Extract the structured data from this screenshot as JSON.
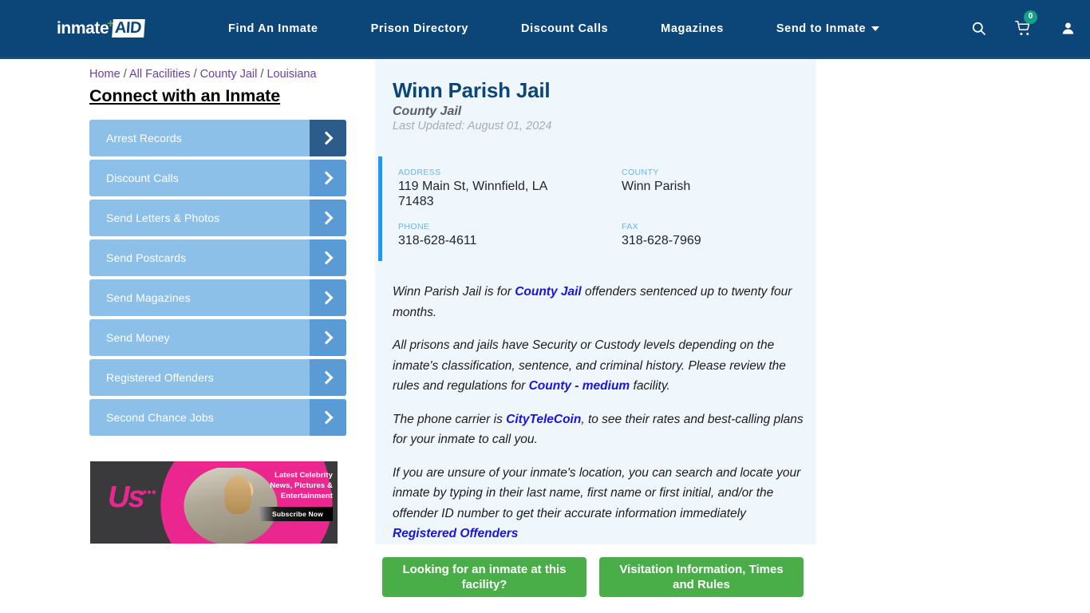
{
  "header": {
    "logo": {
      "word": "inmate",
      "plus": "+",
      "aid": "AID"
    },
    "nav": [
      {
        "label": "Find An Inmate",
        "name": "nav-find-an-inmate"
      },
      {
        "label": "Prison Directory",
        "name": "nav-prison-directory"
      },
      {
        "label": "Discount Calls",
        "name": "nav-discount-calls"
      },
      {
        "label": "Magazines",
        "name": "nav-magazines"
      },
      {
        "label": "Send to Inmate",
        "name": "nav-send-to-inmate",
        "dropdown": true
      }
    ],
    "icons": {
      "search": "search-icon",
      "cart": "cart-icon",
      "account": "user-account-icon"
    },
    "cart_count": "0",
    "brand_color": "#0c4578",
    "badge_color": "#16a085"
  },
  "breadcrumb": {
    "items": [
      "Home",
      "All Facilities",
      "County Jail",
      "Louisiana"
    ],
    "separator": "/"
  },
  "sidebar": {
    "title": "Connect with an Inmate",
    "items": [
      {
        "label": "Arrest Records"
      },
      {
        "label": "Discount Calls"
      },
      {
        "label": "Send Letters & Photos"
      },
      {
        "label": "Send Postcards"
      },
      {
        "label": "Send Magazines"
      },
      {
        "label": "Send Money"
      },
      {
        "label": "Registered Offenders"
      },
      {
        "label": "Second Chance Jobs"
      }
    ]
  },
  "ad": {
    "logo": "Us",
    "dots": "■■■■",
    "text_line1": "Latest Celebrity",
    "text_line2": "News, Pictures &",
    "text_line3": "Entertainment",
    "cta": "Subscribe Now"
  },
  "facility": {
    "name": "Winn Parish Jail",
    "type": "County Jail",
    "last_updated": "Last Updated: August 01, 2024",
    "fields": [
      {
        "label": "ADDRESS",
        "value": "119 Main St, Winnfield, LA 71483"
      },
      {
        "label": "COUNTY",
        "value": "Winn Parish"
      },
      {
        "label": "PHONE",
        "value": "318-628-4611"
      },
      {
        "label": "FAX",
        "value": "318-628-7969"
      }
    ],
    "accent_color": "#2196f3",
    "card_bg": "#eff7fc"
  },
  "paragraphs": {
    "p1_a": "Winn Parish Jail is for ",
    "p1_link": "County Jail",
    "p1_b": " offenders sentenced up to twenty four months.",
    "p2_a": "All prisons and jails have Security or Custody levels depending on the inmate's classification, sentence, and criminal history. Please review the rules and regulations for ",
    "p2_link": "County - medium",
    "p2_b": " facility.",
    "p3_a": "The phone carrier is ",
    "p3_link": "CityTeleCoin",
    "p3_b": ", to see their rates and best-calling plans for your inmate to call you.",
    "p4_a": "If you are unsure of your inmate's location, you can search and locate your inmate by typing in their last name, first name or first initial, and/or the offender ID number to get their accurate information immediately ",
    "p4_link": "Registered Offenders"
  },
  "cta": {
    "button1": "Looking for an inmate at this facility?",
    "button2": "Visitation Information, Times and Rules",
    "color": "#49ad48"
  }
}
